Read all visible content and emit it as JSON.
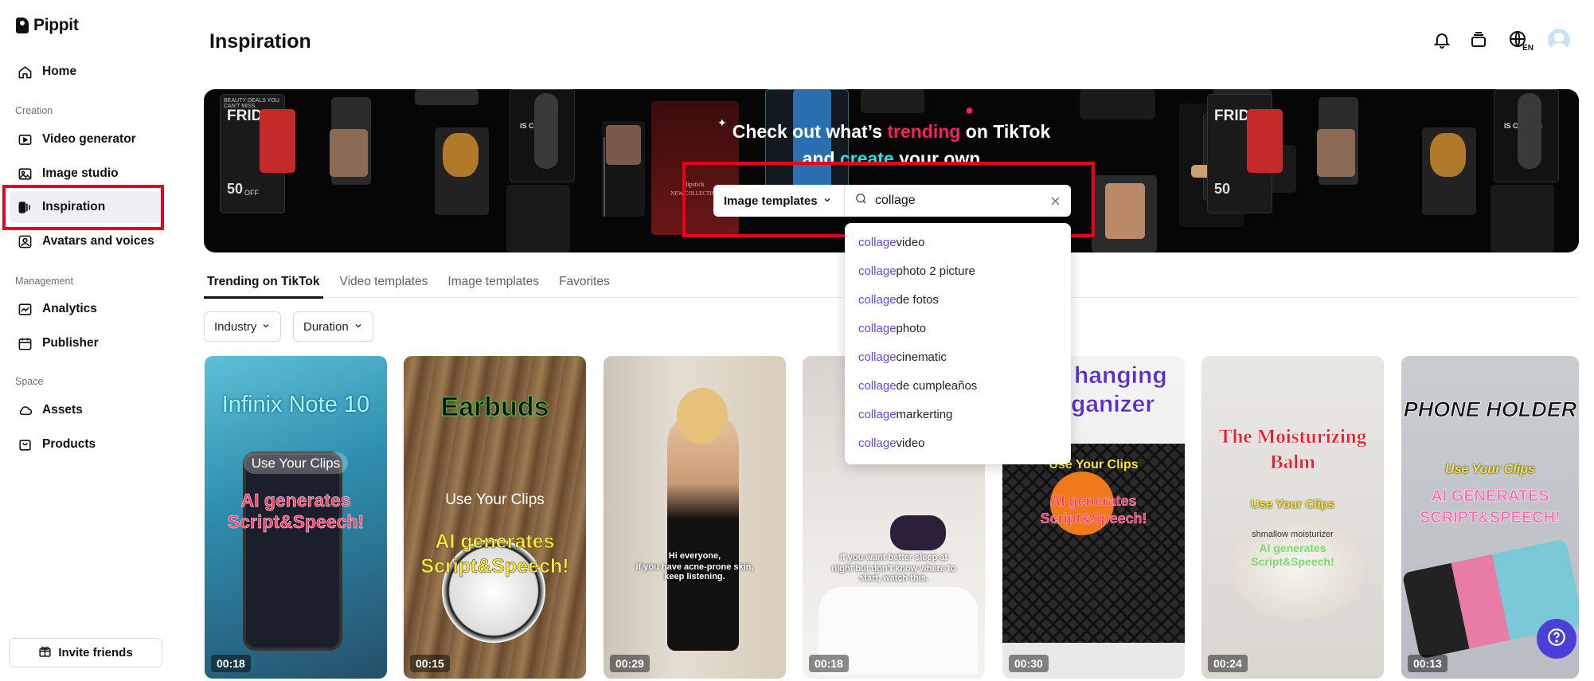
{
  "app": {
    "name": "Pippit"
  },
  "sidebar": {
    "home": "Home",
    "sections": {
      "creation": "Creation",
      "management": "Management",
      "space": "Space"
    },
    "creation_items": [
      {
        "label": "Video generator",
        "icon": "video-generator-icon"
      },
      {
        "label": "Image studio",
        "icon": "image-studio-icon"
      },
      {
        "label": "Inspiration",
        "icon": "inspiration-icon",
        "active": true
      },
      {
        "label": "Avatars and voices",
        "icon": "avatar-voice-icon"
      }
    ],
    "management_items": [
      {
        "label": "Analytics",
        "icon": "analytics-icon"
      },
      {
        "label": "Publisher",
        "icon": "calendar-icon"
      }
    ],
    "space_items": [
      {
        "label": "Assets",
        "icon": "cloud-icon"
      },
      {
        "label": "Products",
        "icon": "bag-icon"
      }
    ],
    "invite_label": "Invite friends"
  },
  "header": {
    "title": "Inspiration",
    "lang_code": "EN"
  },
  "banner": {
    "line1_prefix": "Check out what’s ",
    "line1_accent": "trending",
    "line1_suffix": " on TikTok",
    "line2_prefix": "and ",
    "line2_accent": "create",
    "line2_suffix": " your own",
    "bg_poster_texts": [
      "FRIDAY",
      "IS COMING",
      "50",
      "OFF",
      "lipstick",
      "NEW COLLECTION",
      "BEAUTY DEALS YOU CAN'T MISS"
    ]
  },
  "search": {
    "type_selected": "Image templates",
    "query": "collage"
  },
  "suggestions": [
    {
      "hl": "collage",
      "rest": " video"
    },
    {
      "hl": "collage",
      "rest": "photo 2 picture"
    },
    {
      "hl": "collage",
      "rest": " de fotos"
    },
    {
      "hl": "collage",
      "rest": " photo"
    },
    {
      "hl": "collage",
      "rest": " cinematic"
    },
    {
      "hl": "collage",
      "rest": " de cumpleaños"
    },
    {
      "hl": "collage",
      "rest": " markerting"
    },
    {
      "hl": "collage",
      "rest": "video"
    }
  ],
  "tabs": [
    "Trending on TikTok",
    "Video templates",
    "Image templates",
    "Favorites"
  ],
  "active_tab": "Trending on TikTok",
  "filters": [
    "Industry",
    "Duration"
  ],
  "cards": [
    {
      "title": "Infinix Note 10",
      "sub1": "Use Your Clips",
      "sub2": "AI generates Script&Speech!",
      "duration": "00:18"
    },
    {
      "title": "Earbuds",
      "sub1": "Use Your Clips",
      "sub2": "AI generates Script&Speech!",
      "duration": "00:15"
    },
    {
      "title": "",
      "sub1": "Hi everyone,",
      "sub2": "if you have acne-prone skin, keep listening.",
      "duration": "00:29"
    },
    {
      "title": "",
      "sub1": "If you want better sleep at",
      "sub2": "night but don't know where to start, watch this.",
      "duration": "00:18"
    },
    {
      "title": "hanging",
      "title2": "ganizer",
      "sub1": "Use Your Clips",
      "sub2": "AI generates Script&Speech!",
      "duration": "00:30"
    },
    {
      "title": "The Moisturizing",
      "title2": "Balm",
      "sub1": "Use Your Clips",
      "sub2": "AI generates Script&Speech!",
      "sub3": "shmallow moisturizer",
      "duration": "00:24"
    },
    {
      "title": "PHONE HOLDER",
      "sub1": "Use Your Clips",
      "sub2": "AI GENERATES",
      "sub3": "SCRIPT&SPEECH!",
      "duration": "00:13"
    }
  ],
  "colors": {
    "highlight_red": "#e8001c",
    "accent_purple": "#5b4bd8",
    "trending_pink": "#ff1f5a",
    "create_cyan": "#23e3e8",
    "help_button": "#4a3fd6"
  }
}
